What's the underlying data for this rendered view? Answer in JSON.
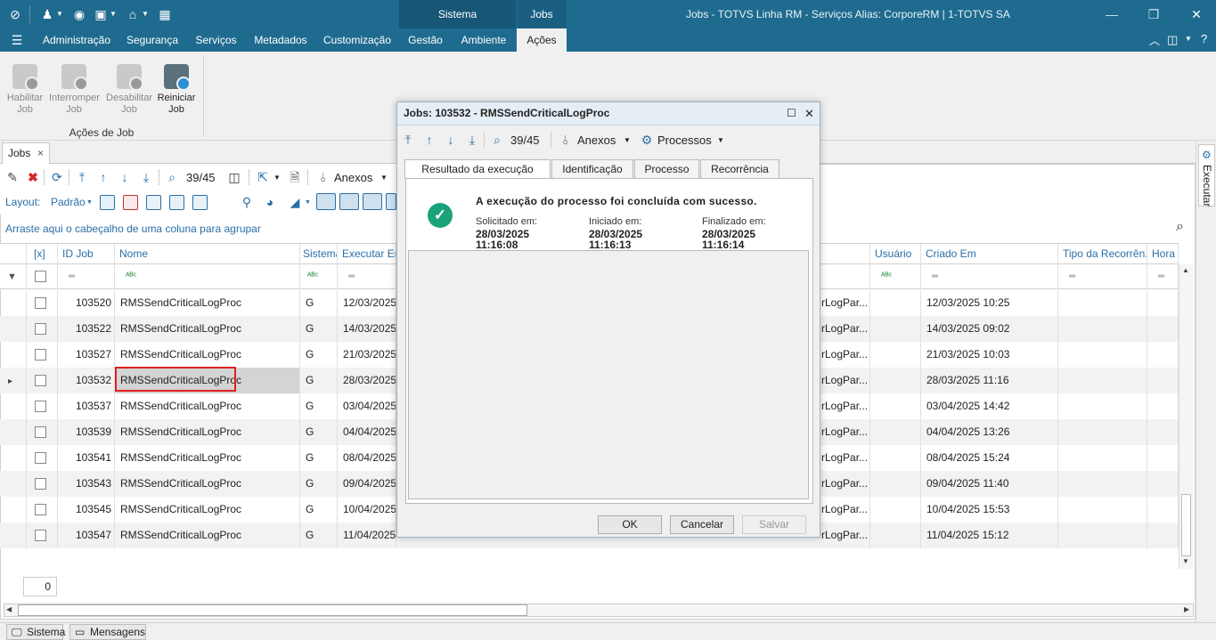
{
  "titlebar": {
    "context_group": "Sistema",
    "context_tab": "Jobs",
    "window_title": "Jobs - TOTVS Linha RM - Serviços  Alias: CorporeRM | 1-TOTVS SA"
  },
  "menubar": {
    "items": [
      "Administração",
      "Segurança",
      "Serviços",
      "Metadados",
      "Customização",
      "Gestão",
      "Ambiente",
      "Ações"
    ],
    "active": "Ações"
  },
  "ribbon": {
    "buttons": [
      {
        "line1": "Habilitar",
        "line2": "Job"
      },
      {
        "line1": "Interromper",
        "line2": "Job"
      },
      {
        "line1": "Desabilitar",
        "line2": "Job"
      },
      {
        "line1": "Reiniciar",
        "line2": "Job"
      }
    ],
    "group_label": "Ações de Job"
  },
  "doc_tab": {
    "label": "Jobs",
    "close": "×"
  },
  "toolbar": {
    "record_position": "39/45",
    "anexos": "Anexos",
    "layout_label": "Layout:",
    "layout_value": "Padrão"
  },
  "group_hint": "Arraste aqui o cabeçalho de uma coluna para agrupar",
  "grid": {
    "headers": {
      "check": "[x]",
      "id": "ID Job",
      "name": "Nome",
      "system": "Sistema",
      "exec": "Executar Em",
      "user": "Usuário",
      "created": "Criado Em",
      "recurrence": "Tipo da Recorrên...",
      "hour": "Hora"
    },
    "rows": [
      {
        "id": "103520",
        "name": "RMSSendCriticalLogProc",
        "system": "G",
        "exec": "12/03/2025",
        "param": "rLogPar...",
        "created": "12/03/2025 10:25"
      },
      {
        "id": "103522",
        "name": "RMSSendCriticalLogProc",
        "system": "G",
        "exec": "14/03/2025",
        "param": "rLogPar...",
        "created": "14/03/2025 09:02"
      },
      {
        "id": "103527",
        "name": "RMSSendCriticalLogProc",
        "system": "G",
        "exec": "21/03/2025",
        "param": "rLogPar...",
        "created": "21/03/2025 10:03"
      },
      {
        "id": "103532",
        "name": "RMSSendCriticalLogProc",
        "system": "G",
        "exec": "28/03/2025",
        "param": "rLogPar...",
        "created": "28/03/2025 11:16"
      },
      {
        "id": "103537",
        "name": "RMSSendCriticalLogProc",
        "system": "G",
        "exec": "03/04/2025",
        "param": "rLogPar...",
        "created": "03/04/2025 14:42"
      },
      {
        "id": "103539",
        "name": "RMSSendCriticalLogProc",
        "system": "G",
        "exec": "04/04/2025",
        "param": "rLogPar...",
        "created": "04/04/2025 13:26"
      },
      {
        "id": "103541",
        "name": "RMSSendCriticalLogProc",
        "system": "G",
        "exec": "08/04/2025",
        "param": "rLogPar...",
        "created": "08/04/2025 15:24"
      },
      {
        "id": "103543",
        "name": "RMSSendCriticalLogProc",
        "system": "G",
        "exec": "09/04/2025",
        "param": "rLogPar...",
        "created": "09/04/2025 11:40"
      },
      {
        "id": "103545",
        "name": "RMSSendCriticalLogProc",
        "system": "G",
        "exec": "10/04/2025",
        "param": "rLogPar...",
        "created": "10/04/2025 15:53"
      },
      {
        "id": "103547",
        "name": "RMSSendCriticalLogProc",
        "system": "G",
        "exec": "11/04/2025",
        "param": "rLogPar...",
        "created": "11/04/2025 15:12"
      }
    ],
    "selected_id": "103532",
    "count": "0"
  },
  "statusbar": {
    "sistema": "Sistema",
    "mensagens": "Mensagens"
  },
  "side_panel": {
    "executar": "Executar"
  },
  "dialog": {
    "title": "Jobs: 103532 - RMSSendCriticalLogProc",
    "record_position": "39/45",
    "anexos": "Anexos",
    "processos": "Processos",
    "tabs": [
      "Resultado da execução",
      "Identificação",
      "Processo",
      "Recorrência"
    ],
    "active_tab": "Resultado da execução",
    "success_message": "A execução do processo foi concluída com sucesso.",
    "requested_label": "Solicitado em:",
    "requested_date": "28/03/2025",
    "requested_time": "11:16:08",
    "started_label": "Iniciado em:",
    "started_date": "28/03/2025",
    "started_time": "11:16:13",
    "finished_label": "Finalizado em:",
    "finished_date": "28/03/2025",
    "finished_time": "11:16:14",
    "ok": "OK",
    "cancel": "Cancelar",
    "save": "Salvar"
  },
  "colors": {
    "titlebar": "#1f6b8f",
    "accent": "#2a6fa8",
    "success": "#1aa37a",
    "selection": "#e02020"
  }
}
